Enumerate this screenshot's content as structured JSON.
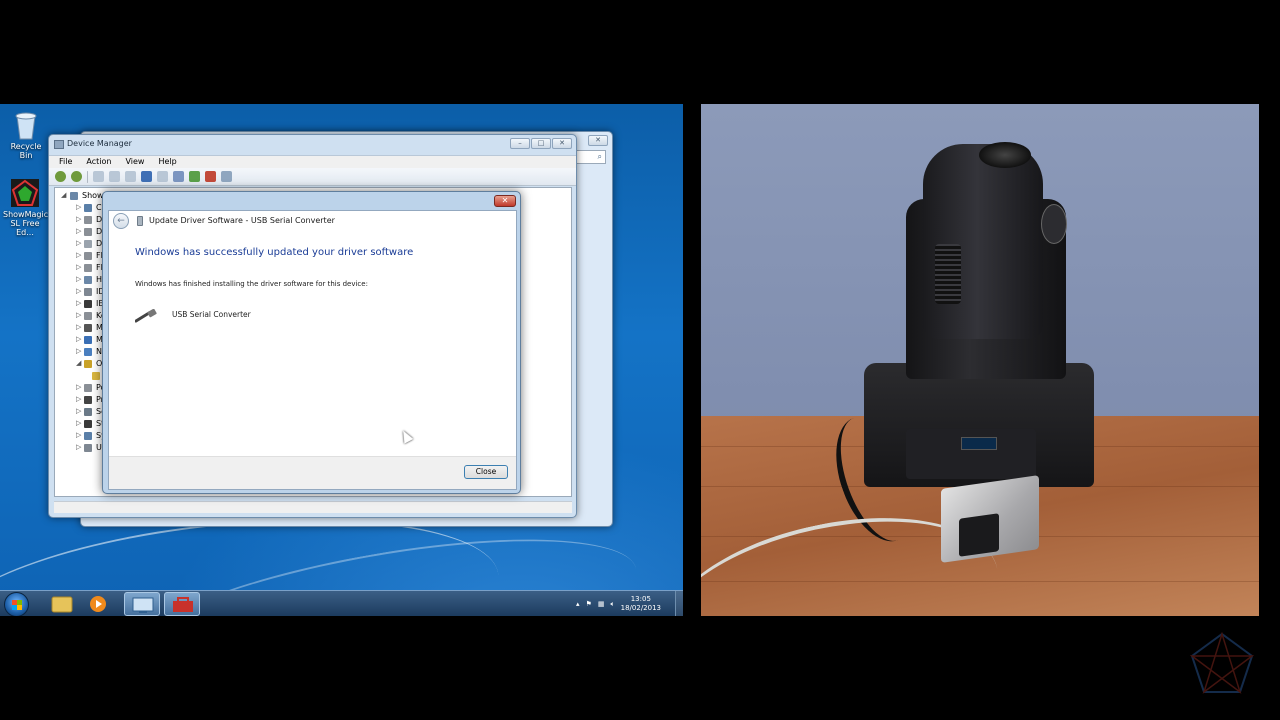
{
  "desktop": {
    "icons": [
      {
        "label": "Recycle Bin",
        "icon": "recycle-bin-icon"
      },
      {
        "label": "ShowMagic SL Free Ed...",
        "icon": "showmagic-app-icon"
      }
    ]
  },
  "device_manager": {
    "title": "Device Manager",
    "menu": [
      "File",
      "Action",
      "View",
      "Help"
    ],
    "tree_root": "Show",
    "tree_rows": [
      "Co",
      "Di",
      "Di",
      "DV",
      "Fl",
      "Fl",
      "Hu",
      "ID",
      "IE",
      "Ke",
      "M",
      "M",
      "Ne",
      "Ot",
      "",
      "Po",
      "Pr",
      "So",
      "St",
      "Sy",
      "Un"
    ]
  },
  "dialog": {
    "title": "Update Driver Software - USB Serial Converter",
    "heading": "Windows has successfully updated your driver software",
    "message": "Windows has finished installing the driver software for this device:",
    "device_name": "USB Serial Converter",
    "close_label": "Close"
  },
  "taskbar": {
    "time": "13:05",
    "date": "18/02/2013"
  },
  "colors": {
    "desktop_blue": "#1473c6",
    "dialog_heading": "#1a3c96",
    "close_button_red": "#c0392b"
  }
}
